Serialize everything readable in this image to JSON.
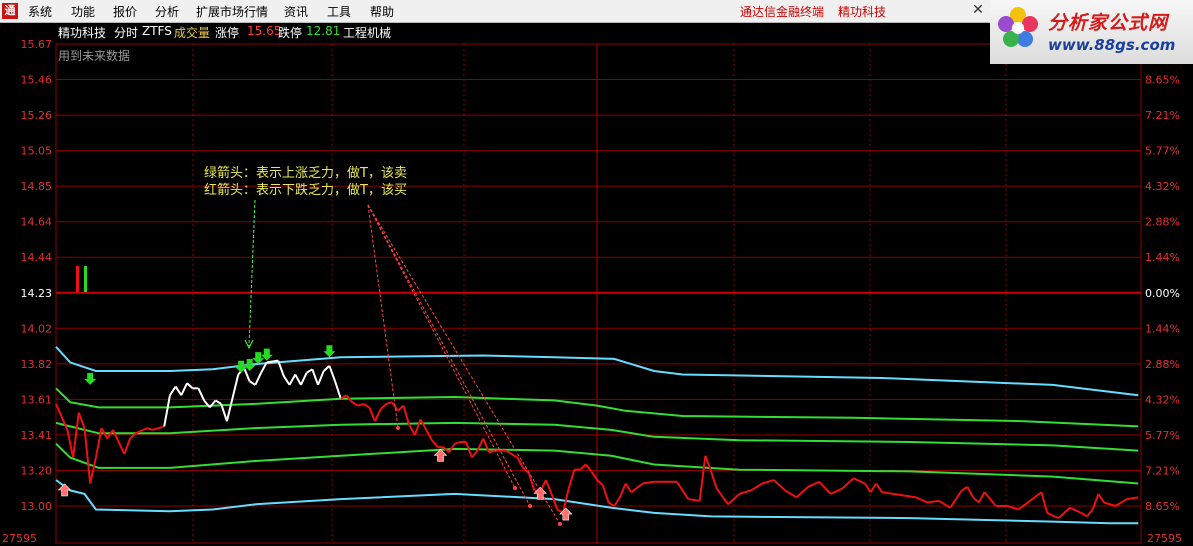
{
  "menu": {
    "items": [
      "系统",
      "功能",
      "报价",
      "分析",
      "扩展市场行情",
      "资讯",
      "工具",
      "帮助"
    ],
    "right_title": "通达信金融终端",
    "right_stock": "精功科技"
  },
  "brand": {
    "title": "分析家公式网",
    "url": "www.88gs.com"
  },
  "info": {
    "stock": "精功科技",
    "view": "分时",
    "indicator": "ZTFS",
    "volume_label": "成交量",
    "limit_up_label": "涨停",
    "limit_up_value": "15.65",
    "limit_down_label": "跌停",
    "limit_down_value": "12.81",
    "sector": "工程机械"
  },
  "hint": "用到未来数据",
  "annotations": {
    "green_line": "绿箭头：表示上涨乏力，做T，该卖",
    "red_line": "红箭头：表示下跌乏力，做T，该买"
  },
  "colors": {
    "background": "#000000",
    "grid": "#8b0000",
    "axis_text_left": "#e03030",
    "axis_text_right": "#e03030",
    "zero_line_text": "#ffffff",
    "band_outer": "#66ddff",
    "band_inner": "#33dd33",
    "price_up": "#ffffff",
    "price_down": "#ee1111",
    "arrow_sell": "#22dd22",
    "arrow_buy": "#ff7070",
    "annotation": "#e8e85a"
  },
  "chart_data": {
    "type": "line",
    "title": "",
    "xlabel": "",
    "ylabel": "",
    "ylim": [
      12.9,
      15.67
    ],
    "y_ticks_left": [
      "15.67",
      "15.46",
      "15.26",
      "15.05",
      "14.85",
      "14.64",
      "14.44",
      "14.23",
      "14.02",
      "13.82",
      "13.61",
      "13.41",
      "13.20",
      "13.00"
    ],
    "y_ticks_right": [
      "",
      "8.65%",
      "7.21%",
      "5.77%",
      "4.32%",
      "2.88%",
      "1.44%",
      "0.00%",
      "1.44%",
      "2.88%",
      "4.32%",
      "5.77%",
      "7.21%",
      "8.65%"
    ],
    "bottom_left_label": "27595",
    "bottom_right_label": "27595",
    "x_range": [
      0,
      240
    ],
    "series": [
      {
        "key": "upper_outer",
        "color": "#66ddff",
        "points": [
          [
            0,
            13.92
          ],
          [
            5,
            13.83
          ],
          [
            14,
            13.78
          ],
          [
            40,
            13.78
          ],
          [
            55,
            13.79
          ],
          [
            70,
            13.82
          ],
          [
            100,
            13.86
          ],
          [
            150,
            13.87
          ],
          [
            175,
            13.86
          ],
          [
            196,
            13.85
          ],
          [
            210,
            13.78
          ],
          [
            220,
            13.76
          ],
          [
            290,
            13.74
          ],
          [
            350,
            13.7
          ],
          [
            380,
            13.64
          ]
        ]
      },
      {
        "key": "upper_inner",
        "color": "#33dd33",
        "points": [
          [
            0,
            13.68
          ],
          [
            5,
            13.6
          ],
          [
            15,
            13.57
          ],
          [
            40,
            13.57
          ],
          [
            70,
            13.59
          ],
          [
            100,
            13.62
          ],
          [
            140,
            13.63
          ],
          [
            175,
            13.61
          ],
          [
            190,
            13.58
          ],
          [
            200,
            13.55
          ],
          [
            220,
            13.52
          ],
          [
            280,
            13.51
          ],
          [
            340,
            13.49
          ],
          [
            380,
            13.46
          ]
        ]
      },
      {
        "key": "mid_inner",
        "color": "#33dd33",
        "points": [
          [
            0,
            13.48
          ],
          [
            5,
            13.46
          ],
          [
            15,
            13.42
          ],
          [
            40,
            13.42
          ],
          [
            70,
            13.45
          ],
          [
            100,
            13.47
          ],
          [
            140,
            13.48
          ],
          [
            175,
            13.47
          ],
          [
            195,
            13.44
          ],
          [
            210,
            13.4
          ],
          [
            240,
            13.38
          ],
          [
            300,
            13.37
          ],
          [
            350,
            13.35
          ],
          [
            380,
            13.32
          ]
        ]
      },
      {
        "key": "lower_inner",
        "color": "#33dd33",
        "points": [
          [
            0,
            13.36
          ],
          [
            5,
            13.28
          ],
          [
            15,
            13.22
          ],
          [
            40,
            13.22
          ],
          [
            70,
            13.26
          ],
          [
            100,
            13.29
          ],
          [
            140,
            13.33
          ],
          [
            175,
            13.32
          ],
          [
            195,
            13.29
          ],
          [
            210,
            13.24
          ],
          [
            240,
            13.21
          ],
          [
            300,
            13.2
          ],
          [
            350,
            13.17
          ],
          [
            380,
            13.13
          ]
        ]
      },
      {
        "key": "lower_outer",
        "color": "#66ddff",
        "points": [
          [
            0,
            13.15
          ],
          [
            5,
            13.09
          ],
          [
            10,
            13.07
          ],
          [
            14,
            12.98
          ],
          [
            40,
            12.97
          ],
          [
            55,
            12.98
          ],
          [
            70,
            13.01
          ],
          [
            100,
            13.04
          ],
          [
            140,
            13.07
          ],
          [
            175,
            13.04
          ],
          [
            195,
            12.99
          ],
          [
            210,
            12.96
          ],
          [
            230,
            12.94
          ],
          [
            300,
            12.93
          ],
          [
            350,
            12.91
          ],
          [
            370,
            12.9
          ],
          [
            380,
            12.9
          ]
        ]
      }
    ],
    "price_line": {
      "up_color": "#ffffff",
      "down_color": "#ee1111",
      "points": [
        [
          0,
          13.59
        ],
        [
          4,
          13.44
        ],
        [
          6,
          13.28
        ],
        [
          8,
          13.54
        ],
        [
          10,
          13.45
        ],
        [
          12,
          13.13
        ],
        [
          14,
          13.28
        ],
        [
          16,
          13.45
        ],
        [
          18,
          13.39
        ],
        [
          20,
          13.44
        ],
        [
          22,
          13.37
        ],
        [
          24,
          13.3
        ],
        [
          26,
          13.39
        ],
        [
          28,
          13.42
        ],
        [
          32,
          13.45
        ],
        [
          34,
          13.44
        ],
        [
          38,
          13.46
        ],
        [
          40,
          13.64
        ],
        [
          42,
          13.69
        ],
        [
          44,
          13.64
        ],
        [
          46,
          13.71
        ],
        [
          48,
          13.68
        ],
        [
          50,
          13.68
        ],
        [
          52,
          13.61
        ],
        [
          54,
          13.57
        ],
        [
          56,
          13.61
        ],
        [
          58,
          13.59
        ],
        [
          60,
          13.49
        ],
        [
          64,
          13.76
        ],
        [
          66,
          13.8
        ],
        [
          68,
          13.72
        ],
        [
          70,
          13.7
        ],
        [
          72,
          13.77
        ],
        [
          74,
          13.83
        ],
        [
          78,
          13.84
        ],
        [
          80,
          13.75
        ],
        [
          82,
          13.7
        ],
        [
          84,
          13.76
        ],
        [
          86,
          13.7
        ],
        [
          88,
          13.77
        ],
        [
          90,
          13.79
        ],
        [
          92,
          13.7
        ],
        [
          94,
          13.78
        ],
        [
          96,
          13.81
        ],
        [
          98,
          13.72
        ],
        [
          100,
          13.62
        ],
        [
          102,
          13.64
        ],
        [
          104,
          13.6
        ],
        [
          106,
          13.58
        ],
        [
          108,
          13.59
        ],
        [
          110,
          13.57
        ],
        [
          112,
          13.49
        ],
        [
          114,
          13.56
        ],
        [
          116,
          13.59
        ],
        [
          118,
          13.6
        ],
        [
          120,
          13.55
        ],
        [
          122,
          13.58
        ],
        [
          124,
          13.47
        ],
        [
          126,
          13.41
        ],
        [
          128,
          13.5
        ],
        [
          130,
          13.44
        ],
        [
          132,
          13.38
        ],
        [
          134,
          13.34
        ],
        [
          136,
          13.34
        ],
        [
          138,
          13.31
        ],
        [
          140,
          13.36
        ],
        [
          142,
          13.37
        ],
        [
          144,
          13.37
        ],
        [
          146,
          13.28
        ],
        [
          148,
          13.32
        ],
        [
          150,
          13.39
        ],
        [
          152,
          13.31
        ],
        [
          154,
          13.32
        ],
        [
          158,
          13.32
        ],
        [
          162,
          13.28
        ],
        [
          164,
          13.22
        ],
        [
          166,
          13.19
        ],
        [
          168,
          13.09
        ],
        [
          170,
          13.08
        ],
        [
          172,
          13.15
        ],
        [
          174,
          13.07
        ],
        [
          176,
          12.98
        ],
        [
          178,
          12.96
        ],
        [
          180,
          13.1
        ],
        [
          182,
          13.21
        ],
        [
          184,
          13.21
        ],
        [
          186,
          13.24
        ],
        [
          188,
          13.2
        ],
        [
          190,
          13.15
        ],
        [
          192,
          13.12
        ],
        [
          194,
          13.02
        ],
        [
          196,
          13.0
        ],
        [
          198,
          13.05
        ],
        [
          200,
          13.13
        ],
        [
          202,
          13.08
        ],
        [
          206,
          13.13
        ],
        [
          210,
          13.14
        ],
        [
          214,
          13.14
        ],
        [
          218,
          13.14
        ],
        [
          222,
          13.04
        ],
        [
          226,
          13.03
        ],
        [
          228,
          13.29
        ],
        [
          230,
          13.2
        ],
        [
          232,
          13.1
        ],
        [
          236,
          13.01
        ],
        [
          240,
          13.07
        ],
        [
          244,
          13.09
        ],
        [
          248,
          13.13
        ],
        [
          252,
          13.15
        ],
        [
          256,
          13.09
        ],
        [
          260,
          13.05
        ],
        [
          264,
          13.11
        ],
        [
          268,
          13.14
        ],
        [
          272,
          13.07
        ],
        [
          276,
          13.1
        ],
        [
          280,
          13.16
        ],
        [
          284,
          13.13
        ],
        [
          286,
          13.08
        ],
        [
          288,
          13.13
        ],
        [
          290,
          13.08
        ],
        [
          294,
          13.07
        ],
        [
          298,
          13.06
        ],
        [
          302,
          13.05
        ],
        [
          306,
          13.02
        ],
        [
          310,
          13.03
        ],
        [
          314,
          12.99
        ],
        [
          316,
          13.04
        ],
        [
          318,
          13.09
        ],
        [
          320,
          13.11
        ],
        [
          322,
          13.05
        ],
        [
          324,
          13.02
        ],
        [
          326,
          13.08
        ],
        [
          330,
          13.0
        ],
        [
          334,
          13.0
        ],
        [
          338,
          12.98
        ],
        [
          342,
          13.03
        ],
        [
          346,
          13.08
        ],
        [
          348,
          12.96
        ],
        [
          352,
          12.93
        ],
        [
          356,
          12.99
        ],
        [
          360,
          12.96
        ],
        [
          362,
          12.94
        ],
        [
          364,
          12.98
        ],
        [
          366,
          13.07
        ],
        [
          368,
          13.02
        ],
        [
          372,
          13.0
        ],
        [
          376,
          13.04
        ],
        [
          380,
          13.05
        ]
      ]
    },
    "sell_arrows": [
      [
        12,
        13.7
      ],
      [
        65,
        13.77
      ],
      [
        68,
        13.78
      ],
      [
        71,
        13.82
      ],
      [
        74,
        13.84
      ],
      [
        96,
        13.86
      ]
    ],
    "buy_arrows": [
      [
        3,
        13.07
      ],
      [
        135,
        13.27
      ],
      [
        170,
        13.05
      ],
      [
        179,
        12.93
      ]
    ],
    "legend_marks": [
      {
        "color": "#ee1111"
      },
      {
        "color": "#22dd22"
      }
    ]
  }
}
